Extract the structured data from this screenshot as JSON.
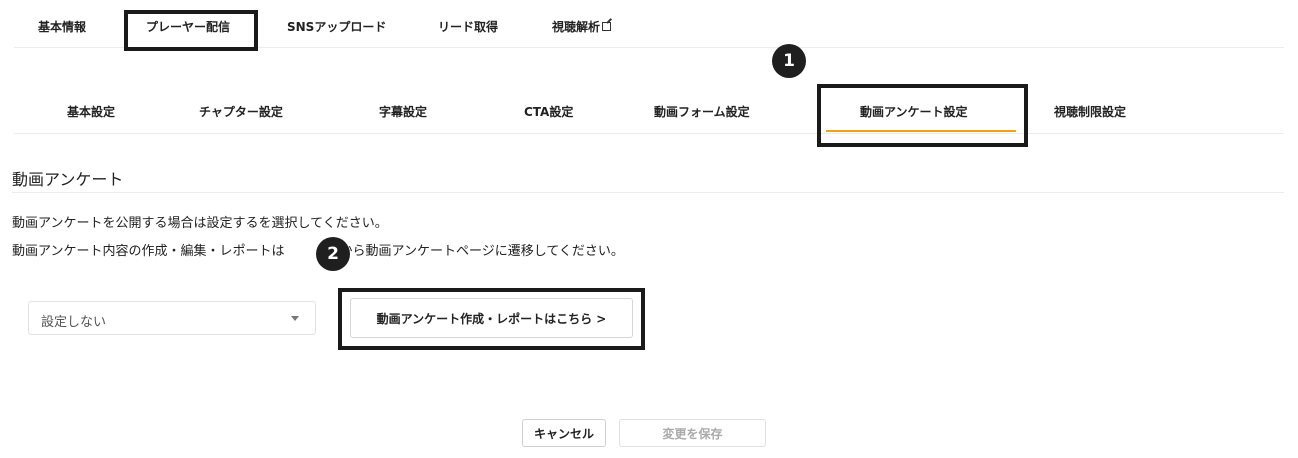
{
  "top_tabs": [
    {
      "label": "基本情報"
    },
    {
      "label": "プレーヤー配信",
      "highlighted": true
    },
    {
      "label": "SNSアップロード"
    },
    {
      "label": "リード取得"
    },
    {
      "label": "視聴解析",
      "external": true
    }
  ],
  "sub_tabs": [
    {
      "label": "基本設定"
    },
    {
      "label": "チャプター設定"
    },
    {
      "label": "字幕設定"
    },
    {
      "label": "CTA設定"
    },
    {
      "label": "動画フォーム設定"
    },
    {
      "label": "動画アンケート設定",
      "active": true
    },
    {
      "label": "視聴制限設定"
    }
  ],
  "badges": {
    "one": "1",
    "two": "2"
  },
  "section": {
    "title": "動画アンケート",
    "desc_line1": "動画アンケートを公開する場合は設定するを選択してください。",
    "desc_line2_a": "動画アンケート内容の作成・編集・レポートは",
    "desc_line2_b": "ンから動画アンケートページに遷移してください。"
  },
  "select": {
    "value": "設定しない"
  },
  "survey_button": {
    "label": "動画アンケート作成・レポートはこちら >"
  },
  "footer": {
    "cancel_label": "キャンセル",
    "save_label": "変更を保存"
  },
  "colors": {
    "accent_underline": "#f0a020",
    "highlight_box": "#1a1a1a",
    "badge": "#1f1f1f"
  }
}
